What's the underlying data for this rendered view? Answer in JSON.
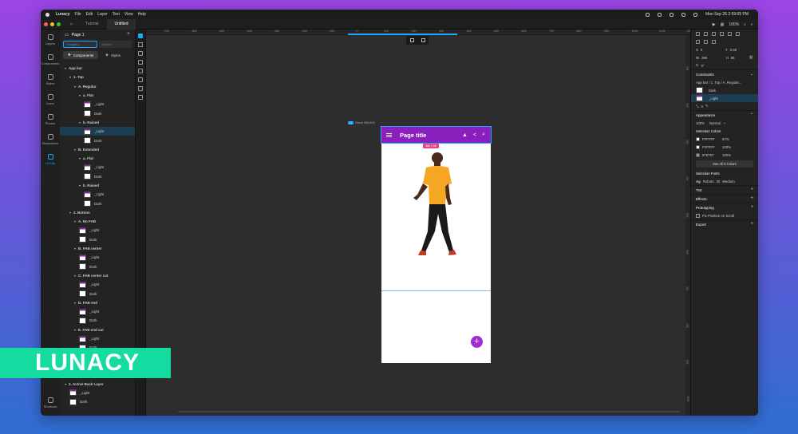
{
  "menubar": {
    "app": "Lunacy",
    "items": [
      "File",
      "Edit",
      "Layer",
      "Text",
      "View",
      "Help"
    ],
    "clock": "Mon Sep 26  2:59:05 PM"
  },
  "tabs": [
    {
      "label": "Tutorial"
    },
    {
      "label": "Untitled"
    }
  ],
  "toolbar": {
    "zoom": "100%"
  },
  "rail": [
    {
      "label": "Layers",
      "icon": "layers-icon"
    },
    {
      "label": "Components",
      "icon": "components-icon"
    },
    {
      "label": "Styles",
      "icon": "styles-icon"
    },
    {
      "label": "Icons",
      "icon": "icons-icon"
    },
    {
      "label": "Photos",
      "icon": "photos-icon"
    },
    {
      "label": "Illustrations",
      "icon": "illustrations-icon"
    },
    {
      "label": "UI Kits",
      "icon": "ui-kits-icon"
    }
  ],
  "rail_bottom": {
    "label": "Shortcuts"
  },
  "layers": {
    "page": "Page 1",
    "search1": "Google U",
    "search2": "Search",
    "tab_components": "Components",
    "tab_styles": "Styles",
    "tree": [
      {
        "label": "App bar",
        "indent": 1,
        "thumb": ""
      },
      {
        "label": "1. Top",
        "indent": 2,
        "thumb": ""
      },
      {
        "label": "A. Regular",
        "indent": 3,
        "thumb": ""
      },
      {
        "label": "a. Flat",
        "indent": 4,
        "thumb": ""
      },
      {
        "label": "_Light",
        "indent": 5,
        "thumb": "light"
      },
      {
        "label": "Dark",
        "indent": 5,
        "thumb": "dark"
      },
      {
        "label": "b. Raised",
        "indent": 4,
        "thumb": ""
      },
      {
        "label": "_Light",
        "indent": 5,
        "thumb": "light",
        "selected": true
      },
      {
        "label": "Dark",
        "indent": 5,
        "thumb": "dark"
      },
      {
        "label": "B. Extended",
        "indent": 3,
        "thumb": ""
      },
      {
        "label": "a. Flat",
        "indent": 4,
        "thumb": ""
      },
      {
        "label": "_Light",
        "indent": 5,
        "thumb": "light"
      },
      {
        "label": "Dark",
        "indent": 5,
        "thumb": "dark"
      },
      {
        "label": "b. Raised",
        "indent": 4,
        "thumb": ""
      },
      {
        "label": "_Light",
        "indent": 5,
        "thumb": "light"
      },
      {
        "label": "Dark",
        "indent": 5,
        "thumb": "dark"
      },
      {
        "label": "2. Bottom",
        "indent": 2,
        "thumb": ""
      },
      {
        "label": "A. No FAB",
        "indent": 3,
        "thumb": ""
      },
      {
        "label": "_Light",
        "indent": 4,
        "thumb": "light"
      },
      {
        "label": "Dark",
        "indent": 4,
        "thumb": "dark"
      },
      {
        "label": "B. FAB center",
        "indent": 3,
        "thumb": ""
      },
      {
        "label": "_Light",
        "indent": 4,
        "thumb": "light"
      },
      {
        "label": "Dark",
        "indent": 4,
        "thumb": "dark"
      },
      {
        "label": "C. FAB center cut",
        "indent": 3,
        "thumb": ""
      },
      {
        "label": "_Light",
        "indent": 4,
        "thumb": "light"
      },
      {
        "label": "Dark",
        "indent": 4,
        "thumb": "dark"
      },
      {
        "label": "D. FAB end",
        "indent": 3,
        "thumb": ""
      },
      {
        "label": "_Light",
        "indent": 4,
        "thumb": "light"
      },
      {
        "label": "Dark",
        "indent": 4,
        "thumb": "dark"
      },
      {
        "label": "E. FAB end cut",
        "indent": 3,
        "thumb": ""
      },
      {
        "label": "_Light",
        "indent": 4,
        "thumb": "light"
      },
      {
        "label": "Dark",
        "indent": 4,
        "thumb": "dark"
      },
      {
        "label": "",
        "indent": 4,
        "thumb": ""
      },
      {
        "label": "",
        "indent": 4,
        "thumb": ""
      },
      {
        "label": "Dark",
        "indent": 2,
        "thumb": "dark"
      },
      {
        "label": "2. Active Back Layer",
        "indent": 1,
        "thumb": ""
      },
      {
        "label": "_Light",
        "indent": 2,
        "thumb": "light"
      },
      {
        "label": "Dark",
        "indent": 2,
        "thumb": "dark"
      }
    ]
  },
  "ruler": [
    "-700",
    "-600",
    "-500",
    "-400",
    "-300",
    "-200",
    "-100",
    "0",
    "100",
    "200",
    "300",
    "400",
    "500",
    "600",
    "700",
    "800",
    "900",
    "1000",
    "1100",
    "1200"
  ],
  "vruler": [
    "100",
    "200",
    "300",
    "400",
    "500",
    "600",
    "700",
    "800",
    "900",
    "1000"
  ],
  "artboard": {
    "badge": "▢",
    "name": "Board 360x640",
    "size": "360 × 56"
  },
  "appbar": {
    "title": "Page title",
    "bell": "▲",
    "share": "<",
    "search": "⌕"
  },
  "fab": "+",
  "props": {
    "x_label": "X",
    "x_val": "0",
    "y_label": "Y",
    "y_val": "0.59",
    "w_label": "W",
    "w_val": "390",
    "h_label": "H",
    "h_val": "56",
    "r_val": "0°",
    "constraints": "Constraints",
    "path": "App bar / 1. Top / A. Regular...",
    "variant1": "Dark",
    "variant2": "_Light",
    "ratio": "0",
    "appearance": "Appearance",
    "opacity": "100%",
    "blend": "Normal",
    "sel_colors": "Selection Colors",
    "colors": [
      {
        "hex": "FFFFFF",
        "pct": "87%",
        "swatch": "#ffffff"
      },
      {
        "hex": "FFFFFF",
        "pct": "100%",
        "swatch": "#ffffff"
      },
      {
        "hex": "979797",
        "pct": "100%",
        "swatch": "#979797"
      }
    ],
    "see_all": "See All 8 Colors",
    "sel_fonts": "Selection Fonts",
    "font_ag": "Ag",
    "font_name": "Roboto",
    "font_size": "20",
    "font_weight": "Medium",
    "tint": "Tint",
    "effects": "Effects",
    "prototyping": "Prototyping",
    "fix_pos": "Fix Position on Scroll",
    "export": "Export"
  },
  "banner": "LUNACY",
  "colors": {
    "accent": "#1ea7ff",
    "appbar": "#8a1fbe",
    "fab": "#a22bd3",
    "banner": "#14dca0"
  }
}
